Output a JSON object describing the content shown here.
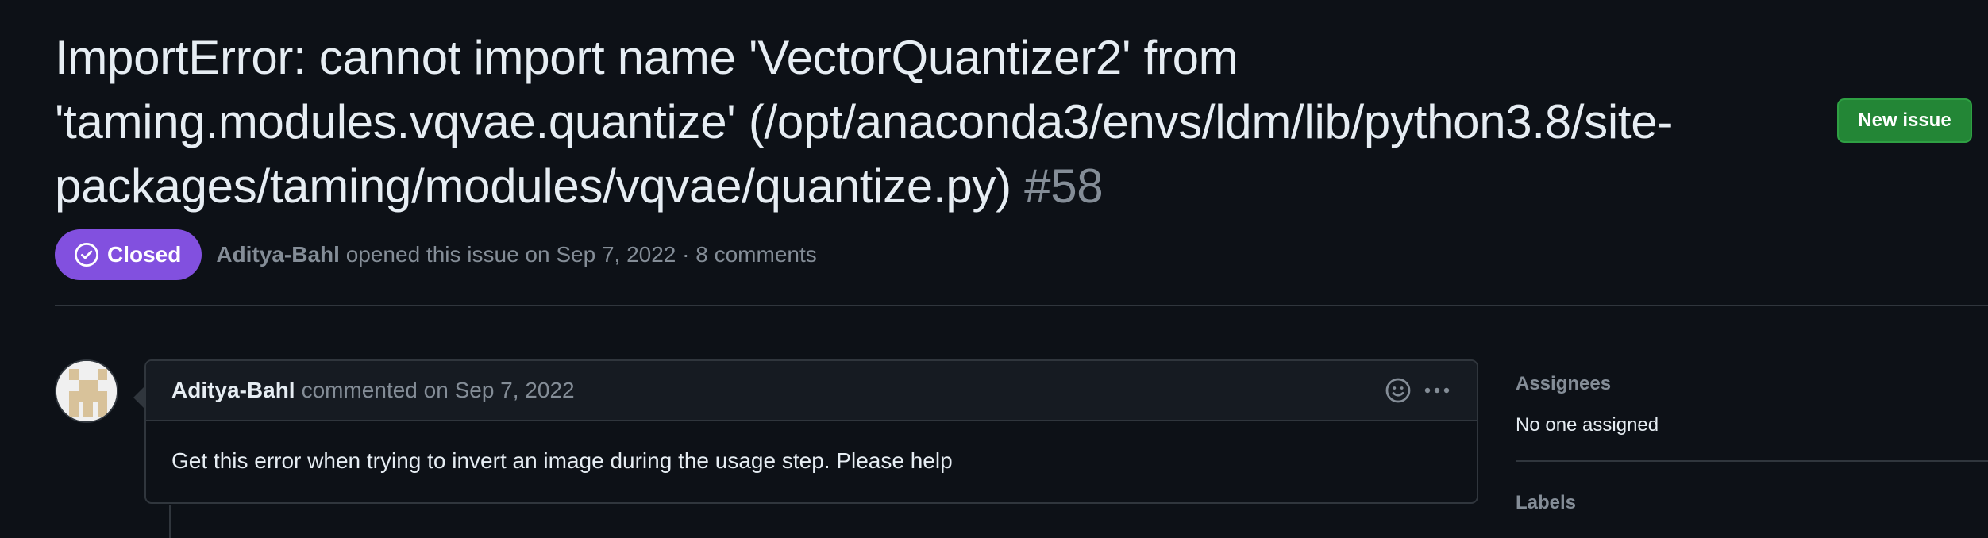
{
  "issue": {
    "title": "ImportError: cannot import name 'VectorQuantizer2' from 'taming.modules.vqvae.quantize' (/opt/anaconda3/envs/ldm/lib/python3.8/site-packages/taming/modules/vqvae/quantize.py)",
    "number": "#58",
    "state": "Closed",
    "state_color": "#8250df",
    "author": "Aditya-Bahl",
    "opened_text": "opened this issue on Sep 7, 2022 · 8 comments"
  },
  "header": {
    "new_issue_label": "New issue",
    "new_issue_color": "#238636"
  },
  "comment": {
    "author": "Aditya-Bahl",
    "date_text": "commented on Sep 7, 2022",
    "body": "Get this error when trying to invert an image during the usage step. Please help",
    "actions": [
      "smiley-icon",
      "kebab-horizontal-icon"
    ]
  },
  "sidebar": {
    "assignees_heading": "Assignees",
    "assignees_value": "No one assigned",
    "labels_heading": "Labels"
  }
}
